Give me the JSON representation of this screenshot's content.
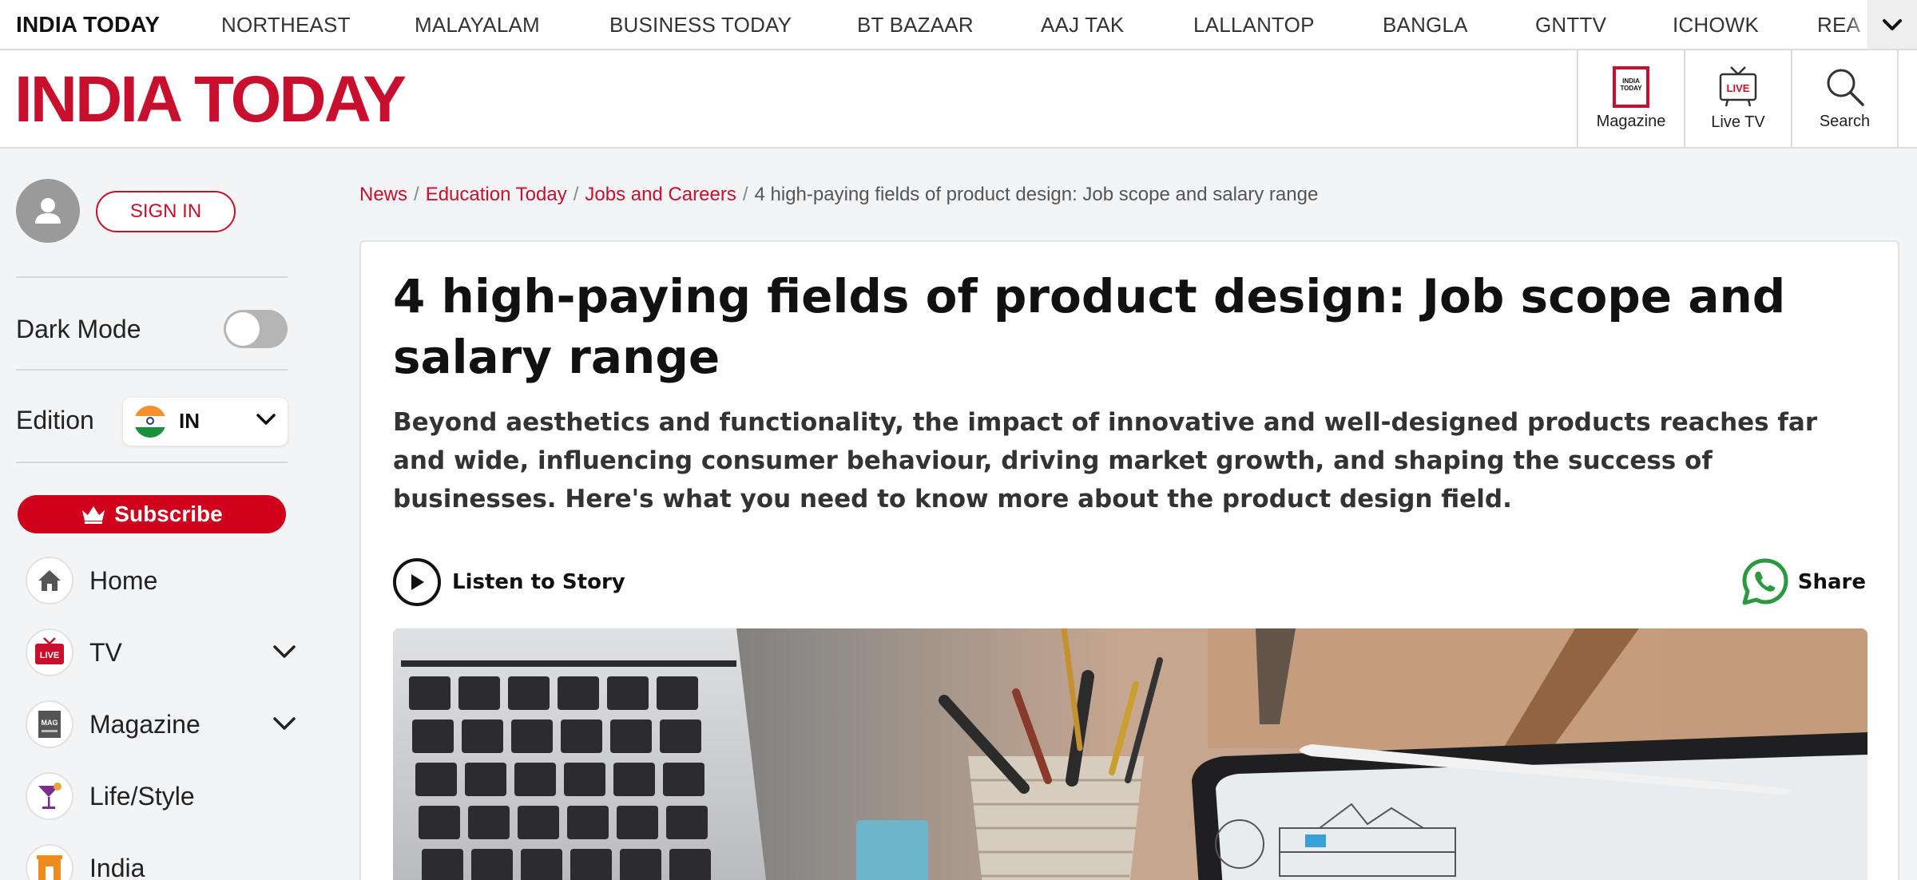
{
  "topbar": {
    "brand": "INDIA TODAY",
    "items": [
      "NORTHEAST",
      "MALAYALAM",
      "BUSINESS TODAY",
      "BT BAZAAR",
      "AAJ TAK",
      "LALLANTOP",
      "BANGLA",
      "GNTTV",
      "ICHOWK",
      "REA"
    ],
    "more_icon": "chevron-down-icon"
  },
  "header": {
    "logo": "INDIA TODAY",
    "magazine_icon_text": "INDIA TODAY",
    "magazine_label": "Magazine",
    "livetv_icon_text": "LIVE",
    "livetv_label": "Live TV",
    "search_label": "Search",
    "brand_color": "#c8102e"
  },
  "sidebar": {
    "sign_in": "SIGN IN",
    "dark_mode_label": "Dark Mode",
    "dark_mode_on": false,
    "edition_label": "Edition",
    "edition_value": "IN",
    "subscribe": "Subscribe",
    "nav": [
      {
        "label": "Home",
        "icon": "home-icon"
      },
      {
        "label": "TV",
        "icon": "live-tv-icon",
        "icon_text": "LIVE",
        "expandable": true
      },
      {
        "label": "Magazine",
        "icon": "magazine-icon",
        "icon_text": "MAG",
        "expandable": true
      },
      {
        "label": "Life/Style",
        "icon": "cocktail-icon"
      },
      {
        "label": "India",
        "icon": "india-gate-icon"
      }
    ]
  },
  "breadcrumb": {
    "items": [
      "News",
      "Education Today",
      "Jobs and Careers"
    ],
    "current": "4 high-paying fields of product design: Job scope and salary range"
  },
  "article": {
    "title": "4 high-paying fields of product design: Job scope and salary range",
    "summary": "Beyond aesthetics and functionality, the impact of innovative and well-designed products reaches far and wide, influencing consumer behaviour, driving market growth, and shaping the success of businesses. Here's what you need to know more about the product design field.",
    "listen_label": "Listen to Story",
    "share_label": "Share",
    "hero_image": "desk-with-laptop-pens-tablet-photo"
  }
}
